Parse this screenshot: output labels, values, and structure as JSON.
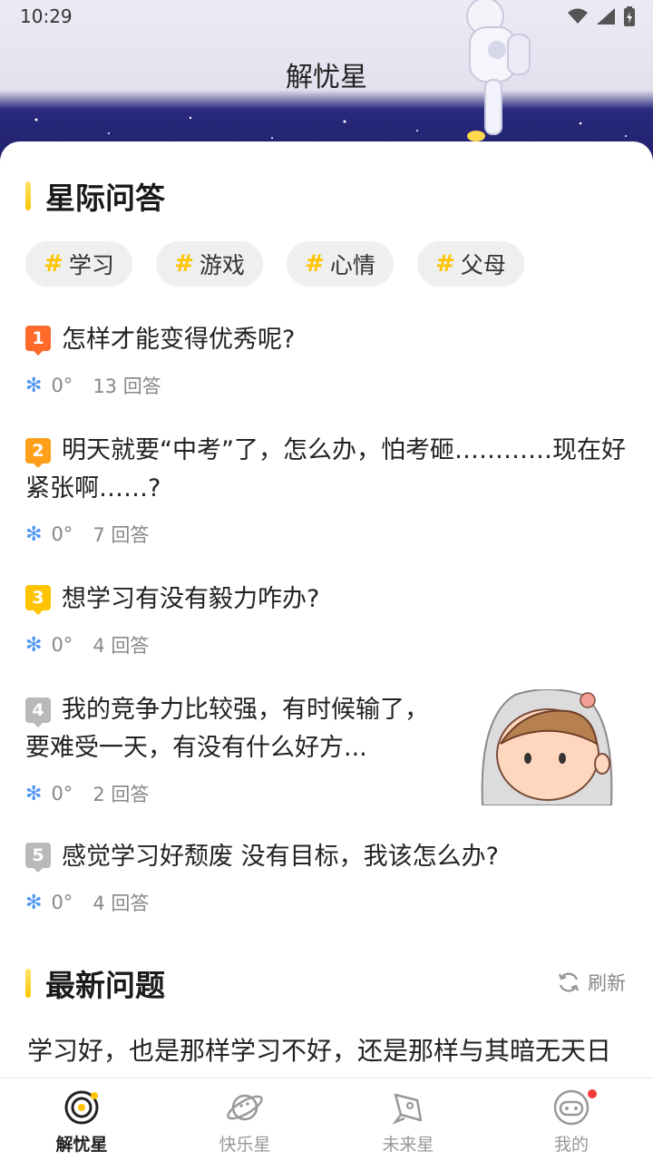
{
  "status_bar": {
    "time": "10:29"
  },
  "header": {
    "title": "解忧星"
  },
  "sections": {
    "qa_title": "星际问答",
    "latest_title": "最新问题",
    "refresh_label": "刷新"
  },
  "tags": [
    {
      "label": "学习"
    },
    {
      "label": "游戏"
    },
    {
      "label": "心情"
    },
    {
      "label": "父母"
    }
  ],
  "tag_hash": "#",
  "questions": [
    {
      "rank": "1",
      "rank_color": "#ff6a2b",
      "text": "怎样才能变得优秀呢?",
      "degree": "0°",
      "answers": "13 回答"
    },
    {
      "rank": "2",
      "rank_color": "#ff9f1a",
      "text": "明天就要“中考”了，怎么办，怕考砸…………现在好紧张啊……?",
      "degree": "0°",
      "answers": "7 回答"
    },
    {
      "rank": "3",
      "rank_color": "#ffc400",
      "text": "想学习有没有毅力咋办?",
      "degree": "0°",
      "answers": "4 回答"
    },
    {
      "rank": "4",
      "rank_color": "#b9b9b9",
      "text": "我的竞争力比较强，有时候输了，要难受一天，有没有什么好方...",
      "degree": "0°",
      "answers": "2 回答"
    },
    {
      "rank": "5",
      "rank_color": "#b9b9b9",
      "text": "感觉学习好颓废 没有目标，我该怎么办?",
      "degree": "0°",
      "answers": "4 回答"
    }
  ],
  "latest": {
    "text": "学习好，也是那样学习不好，还是那样与其暗无天日不如就这了吧?"
  },
  "nav": [
    {
      "label": "解忧星",
      "active": true
    },
    {
      "label": "快乐星",
      "active": false
    },
    {
      "label": "未来星",
      "active": false
    },
    {
      "label": "我的",
      "active": false
    }
  ],
  "colors": {
    "accent": "#ffc400",
    "snowflake": "#4f96f7",
    "badge": "#f23a3a"
  }
}
